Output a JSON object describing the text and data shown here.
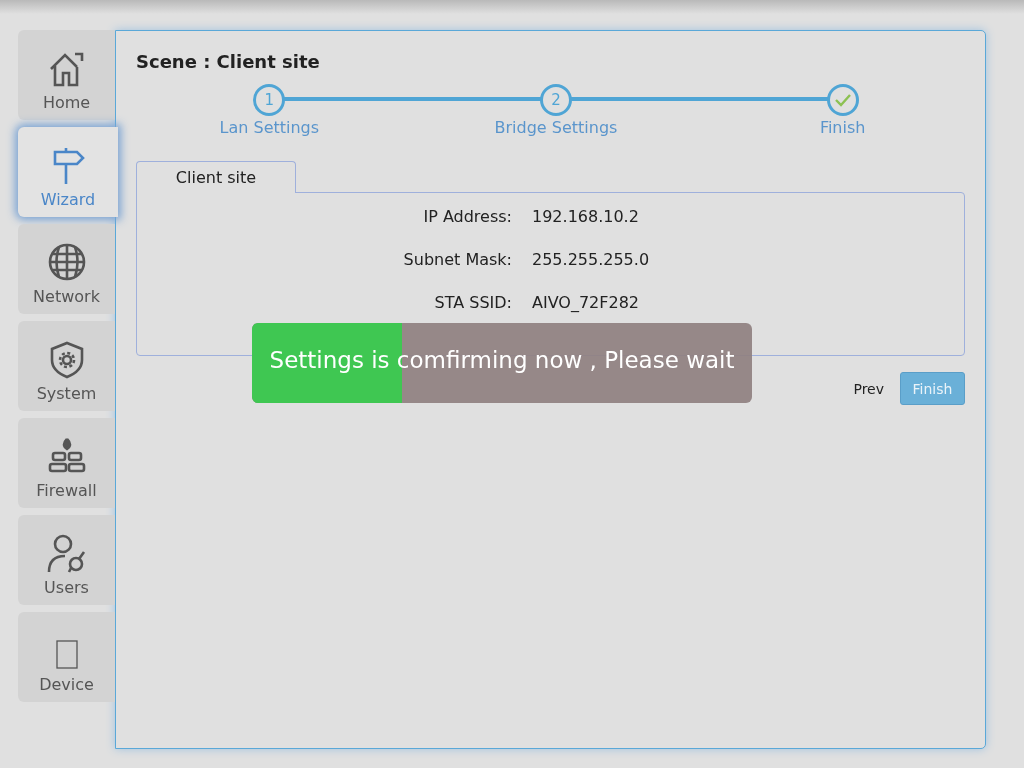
{
  "sidebar": {
    "items": [
      {
        "label": "Home",
        "selected": false
      },
      {
        "label": "Wizard",
        "selected": true
      },
      {
        "label": "Network",
        "selected": false
      },
      {
        "label": "System",
        "selected": false
      },
      {
        "label": "Firewall",
        "selected": false
      },
      {
        "label": "Users",
        "selected": false
      },
      {
        "label": "Device",
        "selected": false
      }
    ]
  },
  "panel": {
    "title": "Scene : Client site",
    "steps": [
      {
        "kind": "number",
        "mark": "1",
        "label": "Lan Settings"
      },
      {
        "kind": "number",
        "mark": "2",
        "label": "Bridge Settings"
      },
      {
        "kind": "check",
        "label": "Finish"
      }
    ],
    "tabs": [
      {
        "label": "Client site",
        "selected": true
      }
    ],
    "fields": [
      {
        "label": "IP Address:",
        "value": "192.168.10.2"
      },
      {
        "label": "Subnet Mask:",
        "value": "255.255.255.0"
      },
      {
        "label": "STA SSID:",
        "value": "AIVO_72F282"
      }
    ],
    "buttons": [
      {
        "kind": "link",
        "label": "Prev"
      },
      {
        "kind": "primary",
        "label": "Finish"
      }
    ]
  },
  "progress": {
    "message": "Settings is comfirming now , Please wait",
    "level": 0.3
  }
}
